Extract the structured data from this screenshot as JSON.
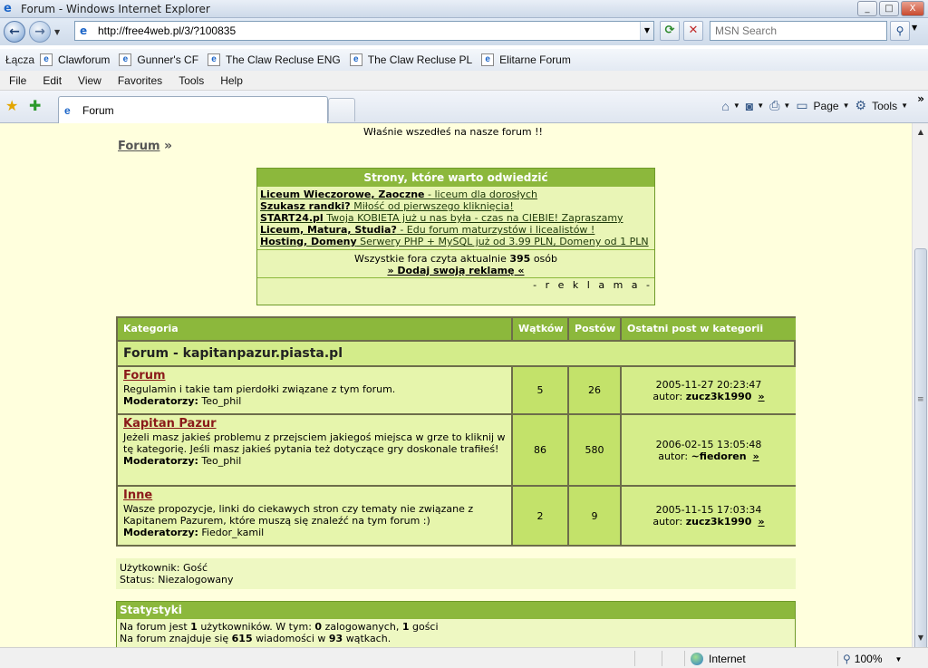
{
  "window": {
    "title": "Forum - Windows Internet Explorer",
    "minimize": "_",
    "maximize": "□",
    "close": "X"
  },
  "address": {
    "url": "http://free4web.pl/3/?100835",
    "search_placeholder": "MSN Search"
  },
  "links": {
    "label": "Łącza",
    "items": [
      "Clawforum",
      "Gunner's CF",
      "The Claw Recluse ENG",
      "The Claw Recluse PL",
      "Elitarne Forum"
    ]
  },
  "menu": [
    "File",
    "Edit",
    "View",
    "Favorites",
    "Tools",
    "Help"
  ],
  "tab": {
    "label": "Forum"
  },
  "toolbar": {
    "page_label": "Page",
    "tools_label": "Tools"
  },
  "page": {
    "welcome": "Właśnie wszedłeś na nasze forum !!",
    "breadcrumb": "Forum",
    "breadcrumb_sep": "»",
    "ads": {
      "header": "Strony, które warto odwiedzić",
      "lines": [
        {
          "bold": "Liceum Wieczorowe, Zaoczne",
          "rest": " - liceum dla dorosłych"
        },
        {
          "bold": "Szukasz randki?",
          "rest": " Miłość od pierwszego kliknięcia!"
        },
        {
          "bold": "START24.pl",
          "rest": " Twoja KOBIETA już u nas była - czas na CIEBIE! Zapraszamy"
        },
        {
          "bold": "Liceum, Matura, Studia?",
          "rest": " - Edu forum maturzystów i licealistów !"
        },
        {
          "bold": "Hosting, Domeny",
          "rest": " Serwery PHP + MySQL już od 3.99 PLN, Domeny od 1 PLN"
        }
      ],
      "count_prefix": "Wszystkie fora czyta aktualnie",
      "count": "395",
      "count_suffix": "osób",
      "add_link": "» Dodaj swoją reklamę «",
      "reklama": "- r e k l a m a -"
    },
    "table": {
      "headers": [
        "Kategoria",
        "Wątków",
        "Postów",
        "Ostatni post w kategorii"
      ],
      "category": "Forum - kapitanpazur.piasta.pl",
      "forums": [
        {
          "name": "Forum",
          "desc": "Regulamin i takie tam pierdołki związane z tym forum.",
          "mod_label": "Moderatorzy:",
          "mod": "Teo_phil",
          "threads": "5",
          "posts": "26",
          "last_date": "2005-11-27 20:23:47",
          "last_author_label": "autor:",
          "last_author": "zucz3k1990",
          "go": "»"
        },
        {
          "name": "Kapitan Pazur",
          "desc": "Jeżeli masz jakieś problemu z przejsciem jakiegoś miejsca w grze to kliknij w tę kategorię. Jeśli masz jakieś pytania też dotyczące gry doskonale trafiłeś!",
          "mod_label": "Moderatorzy:",
          "mod": "Teo_phil",
          "threads": "86",
          "posts": "580",
          "last_date": "2006-02-15 13:05:48",
          "last_author_label": "autor:",
          "last_author": "~fiedoren",
          "go": "»"
        },
        {
          "name": "Inne",
          "desc": "Wasze propozycje, linki do ciekawych stron czy tematy nie związane z Kapitanem Pazurem, które muszą się znaleźć na tym forum :)",
          "mod_label": "Moderatorzy:",
          "mod": "Fiedor_kamil",
          "threads": "2",
          "posts": "9",
          "last_date": "2005-11-15 17:03:34",
          "last_author_label": "autor:",
          "last_author": "zucz3k1990",
          "go": "»"
        }
      ]
    },
    "user": {
      "user_line": "Użytkownik: Gość",
      "status_line": "Status: Niezalogowany"
    },
    "stats": {
      "header": "Statystyki",
      "l1_a": "Na forum jest",
      "users": "1",
      "l1_b": "użytkowników. W tym:",
      "logged": "0",
      "l1_c": "zalogowanych,",
      "guests": "1",
      "l1_d": "gości",
      "l2_a": "Na forum znajduje się",
      "messages": "615",
      "l2_b": "wiadomości w",
      "threads": "93",
      "l2_c": "wątkach."
    }
  },
  "status": {
    "zone": "Internet",
    "zoom": "100%"
  }
}
